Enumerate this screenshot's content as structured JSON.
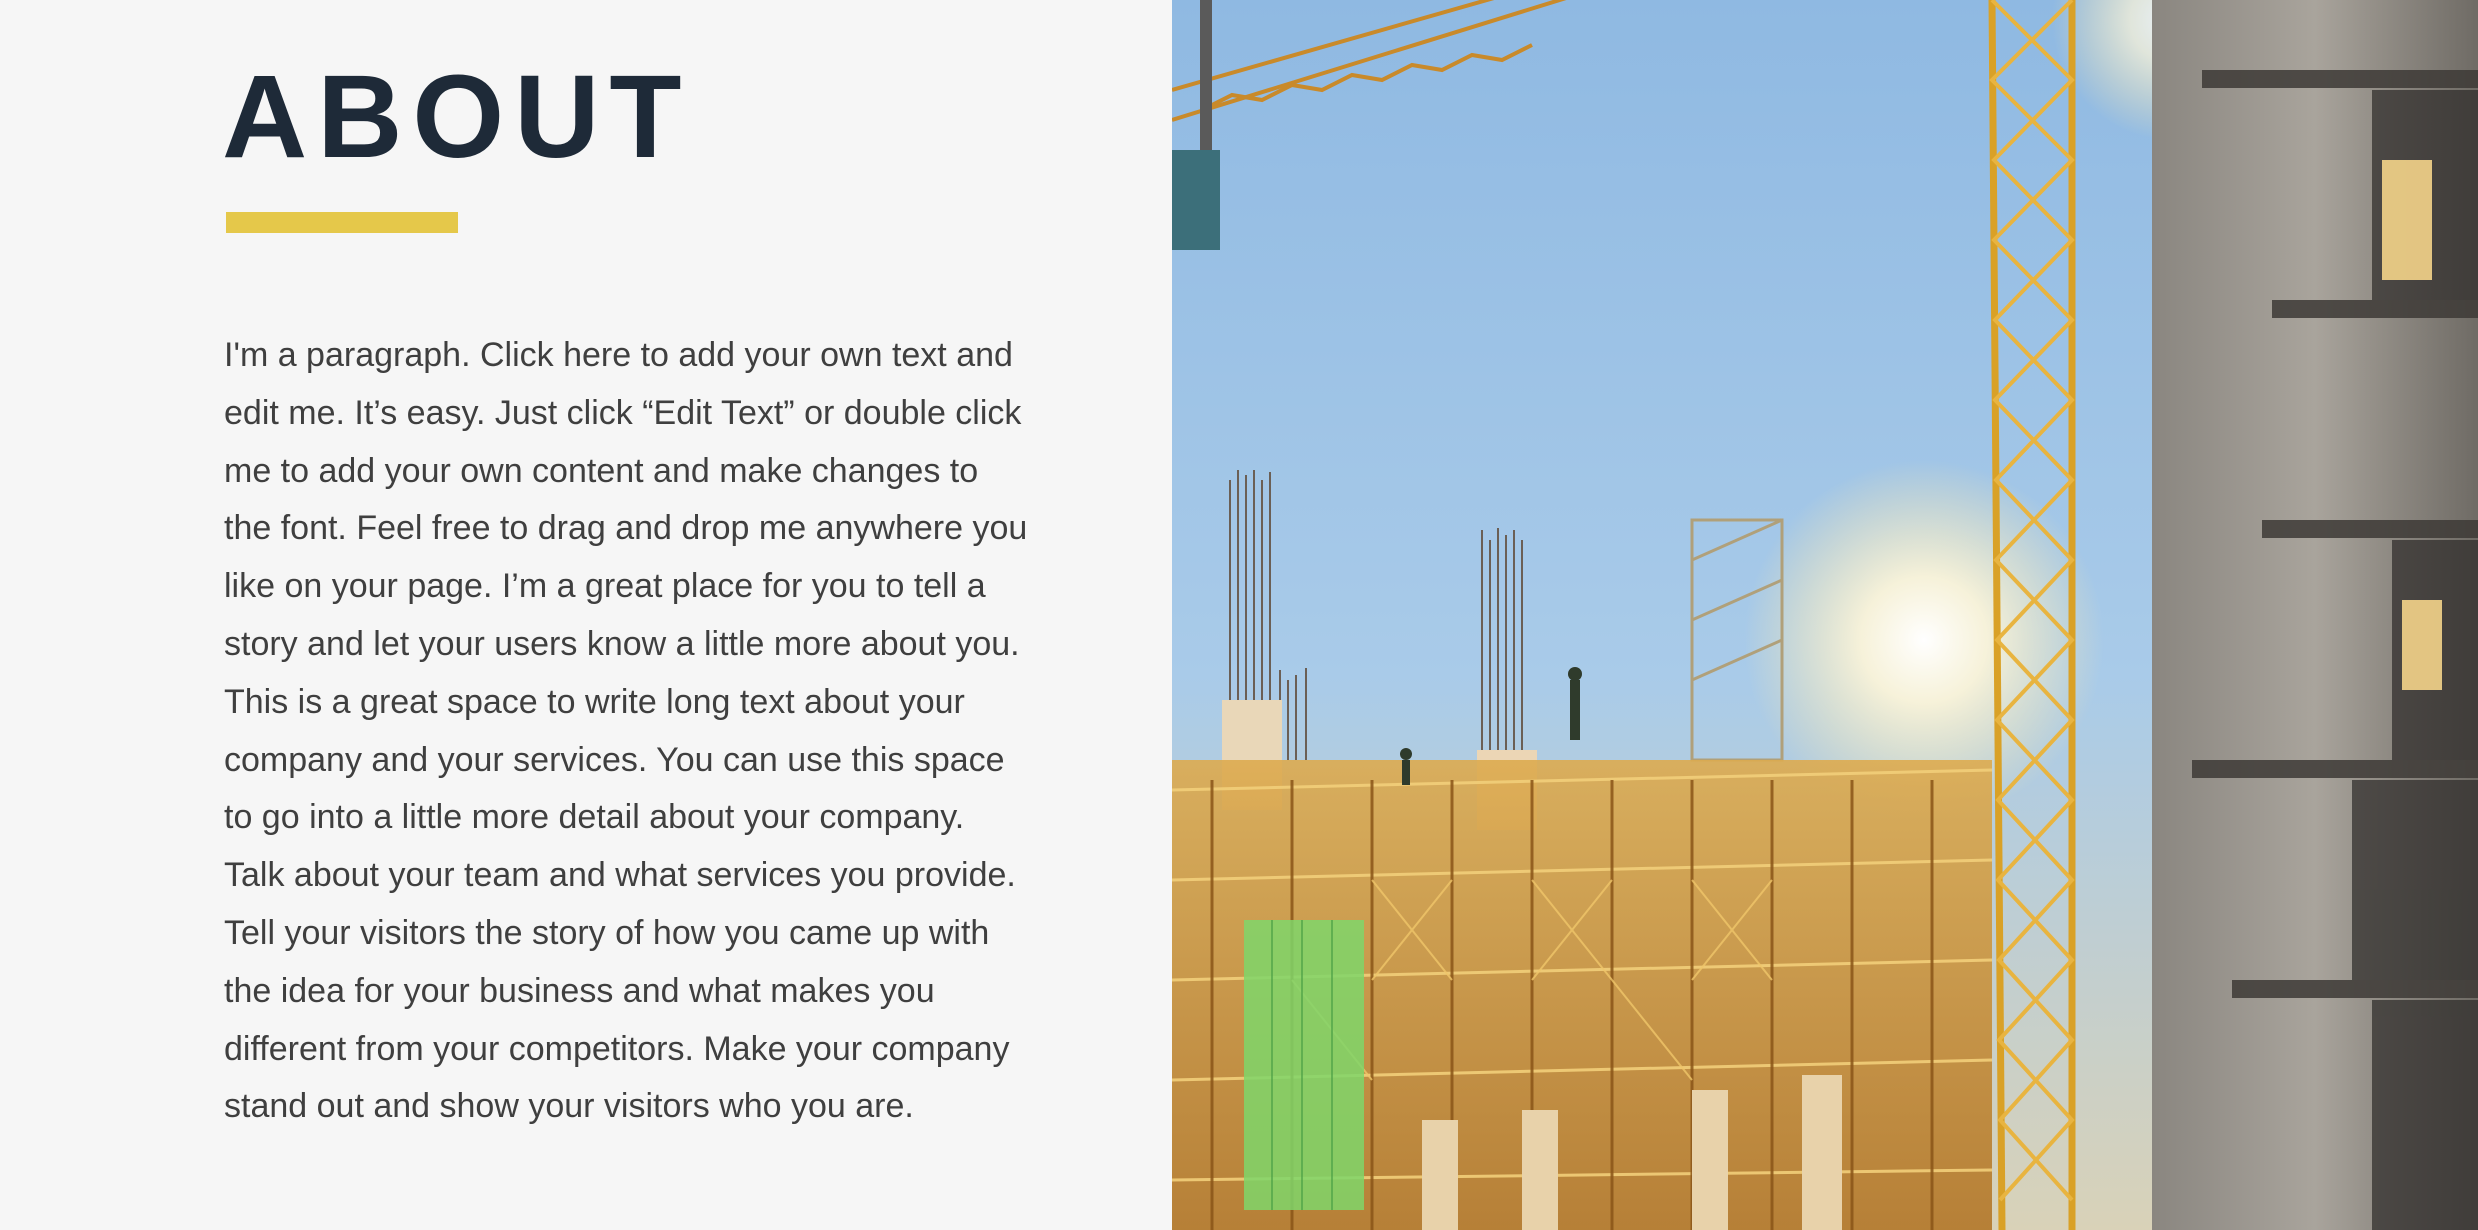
{
  "about": {
    "title": "ABOUT",
    "accent_color": "#e5c84a",
    "title_color": "#1e2a38",
    "paragraph_lines": [
      "I'm a paragraph. Click here to add your own text and",
      "edit me. It’s easy. Just click “Edit Text” or double click",
      "me to add your own content and make changes to",
      "the font. Feel free to drag and drop me anywhere you",
      "like on your page. I’m a great place for you to tell a",
      "story and let your users know a little more about you.",
      "This is a great space to write long text about your",
      "company and your services. You can use this space",
      "to go into a little more detail about your company.",
      "Talk about your team and what services you provide.",
      "Tell your visitors the story of how you came up with",
      "the idea for your business and what makes you",
      "different from your competitors. Make your company",
      "stand out and show your visitors who you are."
    ]
  },
  "image": {
    "subject": "construction-site-photo"
  }
}
